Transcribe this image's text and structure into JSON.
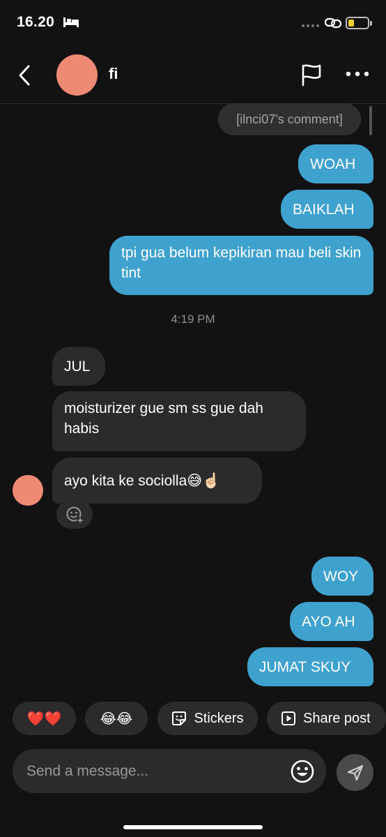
{
  "status_bar": {
    "time": "16.20"
  },
  "header": {
    "contact_name": "fi"
  },
  "comment_label": "[ilnci07's comment]",
  "messages_before": [
    {
      "text": "WOAH"
    },
    {
      "text": "BAIKLAH"
    },
    {
      "text": "tpi gua belum kepikiran mau beli skin tint"
    }
  ],
  "timestamp": "4:19 PM",
  "incoming": [
    {
      "text": "JUL"
    },
    {
      "text": "moisturizer gue sm ss gue dah habis"
    },
    {
      "text": "ayo kita ke sociolla😅☝🏻"
    }
  ],
  "messages_after": [
    {
      "text": "WOY"
    },
    {
      "text": "AYO AH"
    },
    {
      "text": "JUMAT SKUY"
    }
  ],
  "quick_replies": {
    "hearts": "❤️❤️",
    "laughs": "😂😂",
    "stickers": "Stickers",
    "share_post": "Share post"
  },
  "composer": {
    "placeholder": "Send a message..."
  },
  "colors": {
    "outgoing": "#3fa1cd",
    "incoming": "#2b2b2b",
    "avatar": "#ee8a74",
    "background": "#121212"
  }
}
